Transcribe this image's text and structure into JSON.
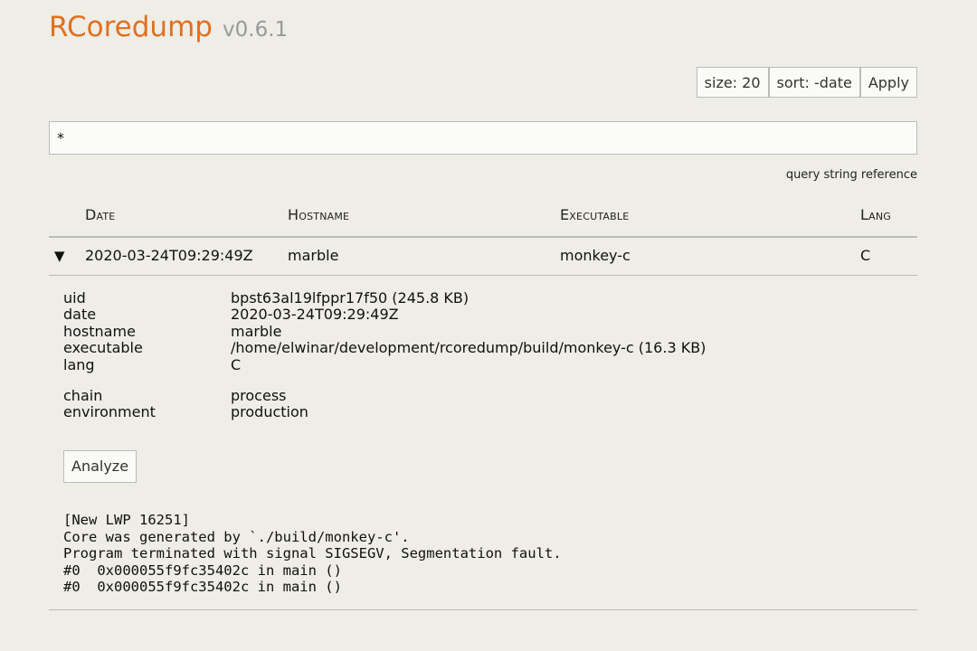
{
  "header": {
    "app_name": "RCoredump",
    "version": "v0.6.1"
  },
  "controls": {
    "size_label": "size: 20",
    "sort_label": "sort: -date",
    "apply_label": "Apply"
  },
  "search": {
    "value": "*"
  },
  "query_ref_label": "query string reference",
  "table": {
    "columns": [
      "Date",
      "Hostname",
      "Executable",
      "Lang"
    ],
    "rows": [
      {
        "toggle_glyph": "▼",
        "date": "2020-03-24T09:29:49Z",
        "hostname": "marble",
        "executable": "monkey-c",
        "lang": "C"
      }
    ]
  },
  "details": {
    "uid_key": "uid",
    "uid_value": "bpst63al19lfppr17f50 (245.8 KB)",
    "date_key": "date",
    "date_value": "2020-03-24T09:29:49Z",
    "hostname_key": "hostname",
    "hostname_value": "marble",
    "executable_key": "executable",
    "executable_value": "/home/elwinar/development/rcoredump/build/monkey-c (16.3 KB)",
    "lang_key": "lang",
    "lang_value": "C",
    "chain_key": "chain",
    "chain_value": "process",
    "environment_key": "environment",
    "environment_value": "production"
  },
  "analyze_label": "Analyze",
  "output_lines": [
    "[New LWP 16251]",
    "Core was generated by `./build/monkey-c'.",
    "Program terminated with signal SIGSEGV, Segmentation fault.",
    "#0  0x000055f9fc35402c in main ()",
    "#0  0x000055f9fc35402c in main ()"
  ],
  "colors": {
    "brand": "#e07020",
    "version": "#999999",
    "background": "#eeede6",
    "border": "#bbbbbb"
  }
}
